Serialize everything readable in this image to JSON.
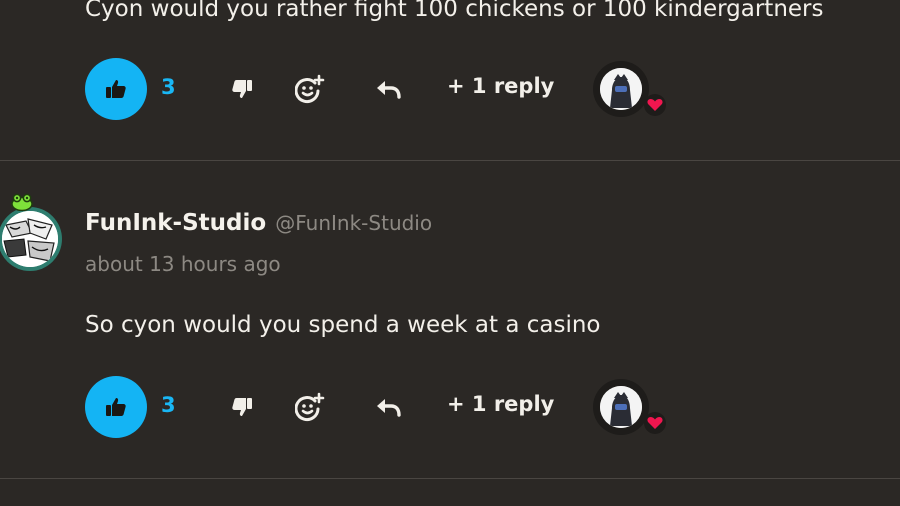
{
  "comments": [
    {
      "text": "Cyon would you rather fight 100 chickens or 100 kindergartners",
      "likes": "3",
      "replies_label": "+ 1 reply"
    },
    {
      "author": "FunInk-Studio",
      "handle": "@FunInk-Studio",
      "timestamp": "about 13 hours ago",
      "text": "So cyon would you spend a week at a casino",
      "likes": "3",
      "replies_label": "+ 1 reply"
    }
  ],
  "colors": {
    "background": "#2b2825",
    "like_accent": "#14b4f4",
    "heart": "#f0164f",
    "avatar_ring": "#2e7d6f"
  },
  "icons": [
    "thumbs-up-icon",
    "thumbs-down-icon",
    "add-reaction-icon",
    "reply-arrow-icon",
    "heart-icon"
  ]
}
